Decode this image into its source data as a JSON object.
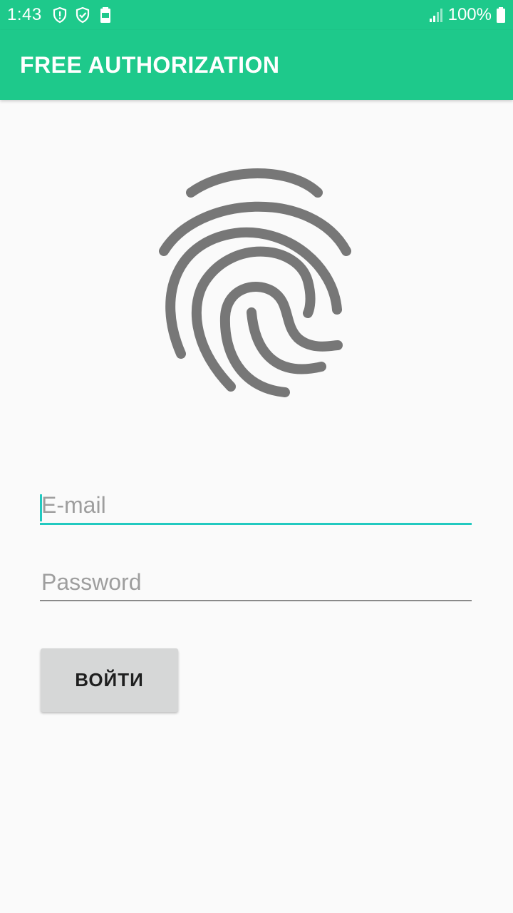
{
  "status_bar": {
    "time": "1:43",
    "battery_percent": "100%",
    "icons": [
      "alert-shield-icon",
      "check-shield-icon",
      "battery-saver-icon",
      "signal-icon",
      "battery-icon"
    ]
  },
  "app_bar": {
    "title": "FREE AUTHORIZATION"
  },
  "fingerprint": {
    "icon": "fingerprint-icon",
    "color": "#777777"
  },
  "form": {
    "email_placeholder": "E-mail",
    "email_value": "",
    "password_placeholder": "Password",
    "password_value": "",
    "login_label": "ВОЙТИ"
  },
  "colors": {
    "primary": "#1ec98b",
    "accent": "#22c9c0",
    "background": "#fafafa",
    "button": "#d6d7d7"
  }
}
